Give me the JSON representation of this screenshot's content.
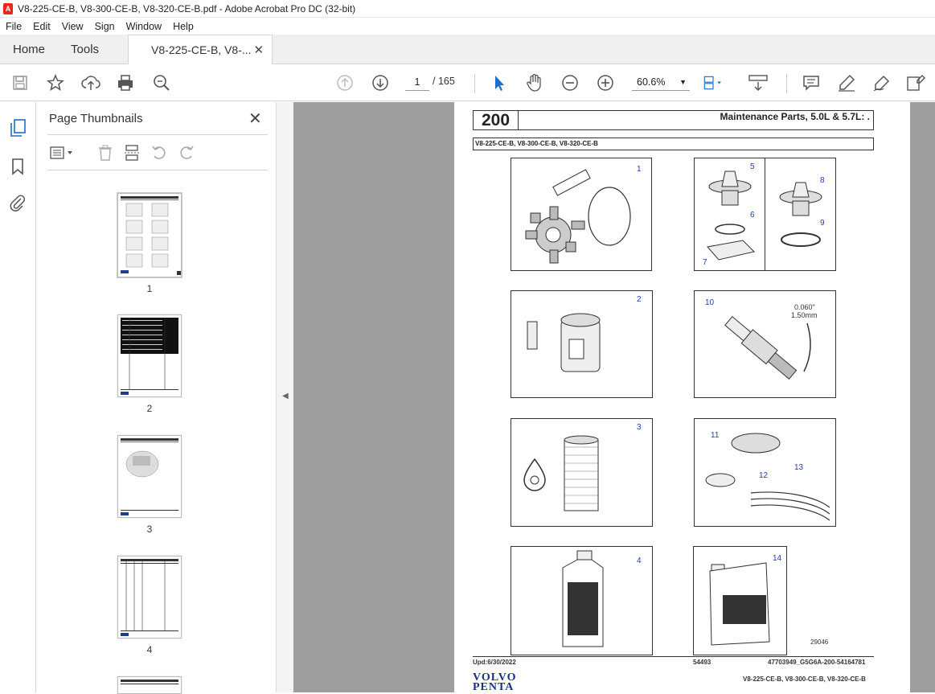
{
  "window": {
    "title": "V8-225-CE-B, V8-300-CE-B, V8-320-CE-B.pdf - Adobe Acrobat Pro DC (32-bit)"
  },
  "menu": [
    "File",
    "Edit",
    "View",
    "Sign",
    "Window",
    "Help"
  ],
  "tabs": {
    "home": "Home",
    "tools": "Tools",
    "doc": "V8-225-CE-B, V8-..."
  },
  "toolbar": {
    "page_current": "1",
    "page_total": "/  165",
    "zoom": "60.6%"
  },
  "panel": {
    "title": "Page Thumbnails",
    "thumbnails": [
      {
        "label": "1"
      },
      {
        "label": "2"
      },
      {
        "label": "3"
      },
      {
        "label": "4"
      }
    ]
  },
  "document": {
    "section_number": "200",
    "section_title": "Maintenance Parts, 5.0L & 5.7L: .",
    "models": "V8-225-CE-B, V8-300-CE-B, V8-320-CE-B",
    "callouts": [
      "1",
      "5",
      "6",
      "7",
      "8",
      "9",
      "2",
      "10",
      "3",
      "11",
      "12",
      "13",
      "4",
      "14"
    ],
    "gap_label": "0.060\"",
    "gap_label_mm": "1.50mm",
    "figure_id": "29046",
    "footer_date": "Upd:6/30/2022",
    "footer_code": "54493",
    "footer_ref": "47703949_G5G6A-200-54164781",
    "footer_models": "V8-225-CE-B, V8-300-CE-B, V8-320-CE-B",
    "brand_line1": "VOLVO",
    "brand_line2": "PENTA"
  },
  "colors": {
    "callout": "#1f3fae",
    "viewer_bg": "#9e9e9e",
    "accent": "#1a6fc9"
  }
}
